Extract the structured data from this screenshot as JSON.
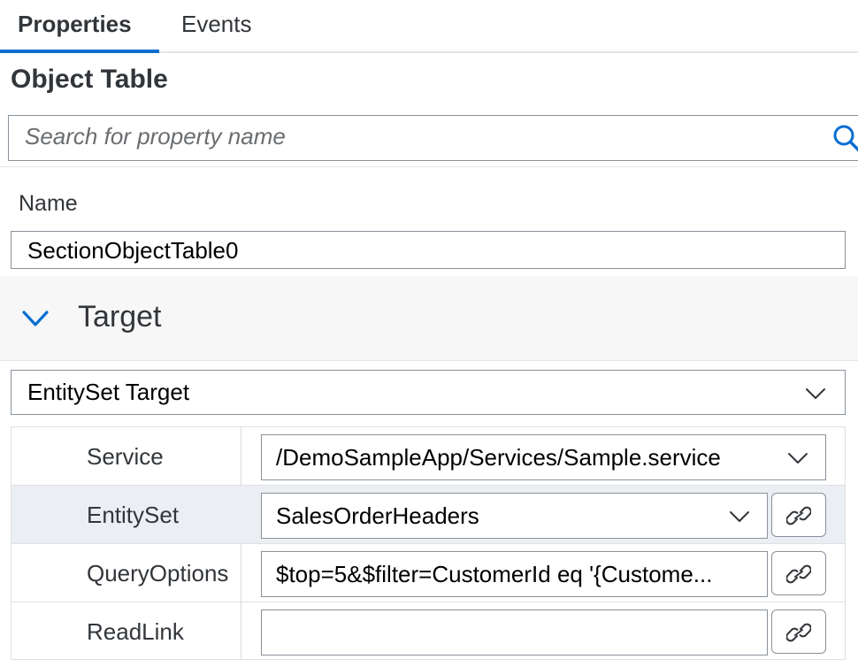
{
  "tabs": [
    {
      "label": "Properties",
      "active": true
    },
    {
      "label": "Events",
      "active": false
    }
  ],
  "object_title": "Object Table",
  "search": {
    "placeholder": "Search for property name",
    "icon": "search-icon"
  },
  "name": {
    "label": "Name",
    "value": "SectionObjectTable0"
  },
  "section": {
    "title": "Target",
    "expanded": true
  },
  "target_type": {
    "value": "EntitySet Target"
  },
  "rows": [
    {
      "label": "Service",
      "value": "/DemoSampleApp/Services/Sample.service",
      "has_dropdown": true,
      "has_link": false
    },
    {
      "label": "EntitySet",
      "value": "SalesOrderHeaders",
      "has_dropdown": true,
      "has_link": true
    },
    {
      "label": "QueryOptions",
      "value": "$top=5&$filter=CustomerId eq '{Custome...",
      "has_dropdown": false,
      "has_link": true
    },
    {
      "label": "ReadLink",
      "value": "",
      "has_dropdown": false,
      "has_link": true
    }
  ],
  "colors": {
    "accent": "#0a6ed1",
    "text": "#32363a",
    "border": "#89919a",
    "row_highlight": "#ebeef2"
  }
}
